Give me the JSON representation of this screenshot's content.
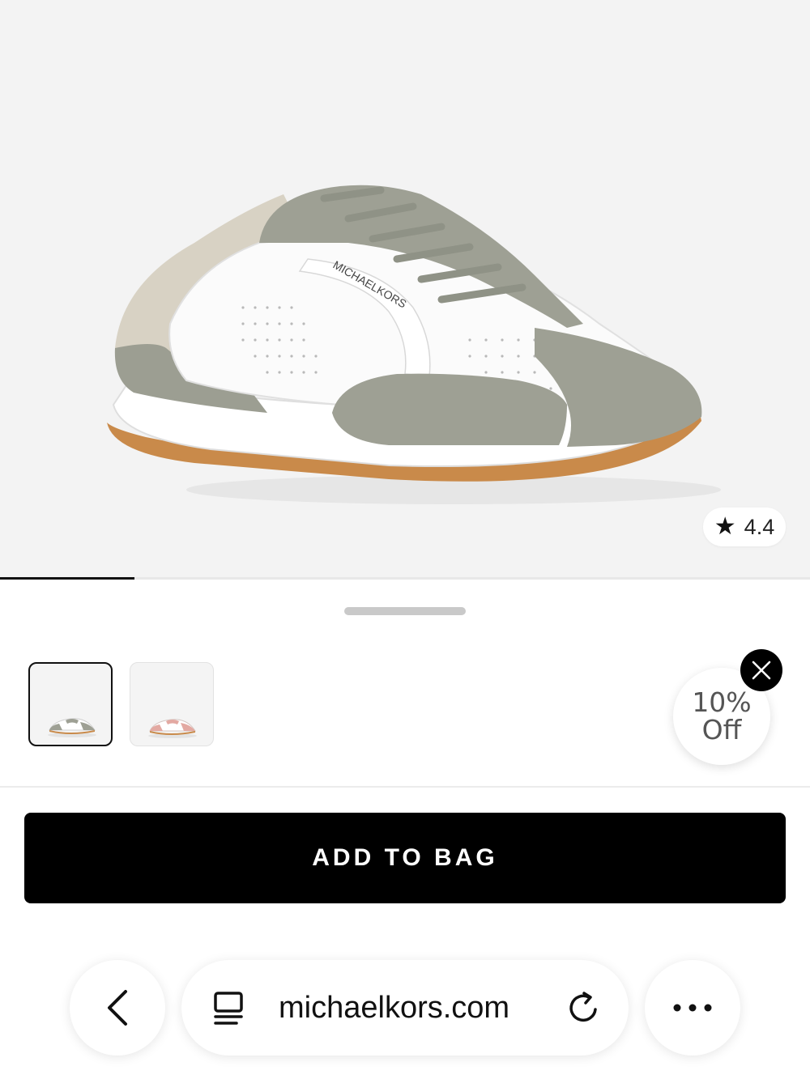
{
  "product": {
    "image_alt": "Michael Kors mule sneaker, grey and white leather with gum sole",
    "brand_text": "MICHAELKORS",
    "rating": "4.4",
    "carousel_progress": 0.166
  },
  "colors": {
    "accent": "#000000",
    "swatch_1": "grey/white",
    "swatch_2": "pink/white"
  },
  "variants": [
    {
      "name": "grey-white",
      "selected": true
    },
    {
      "name": "pink-white",
      "selected": false
    }
  ],
  "promo": {
    "line1": "10%",
    "line2": "Off"
  },
  "actions": {
    "add_to_bag": "ADD TO BAG"
  },
  "browser": {
    "url": "michaelkors.com",
    "icons": [
      "back-icon",
      "page-icon",
      "reload-icon",
      "more-icon"
    ]
  }
}
